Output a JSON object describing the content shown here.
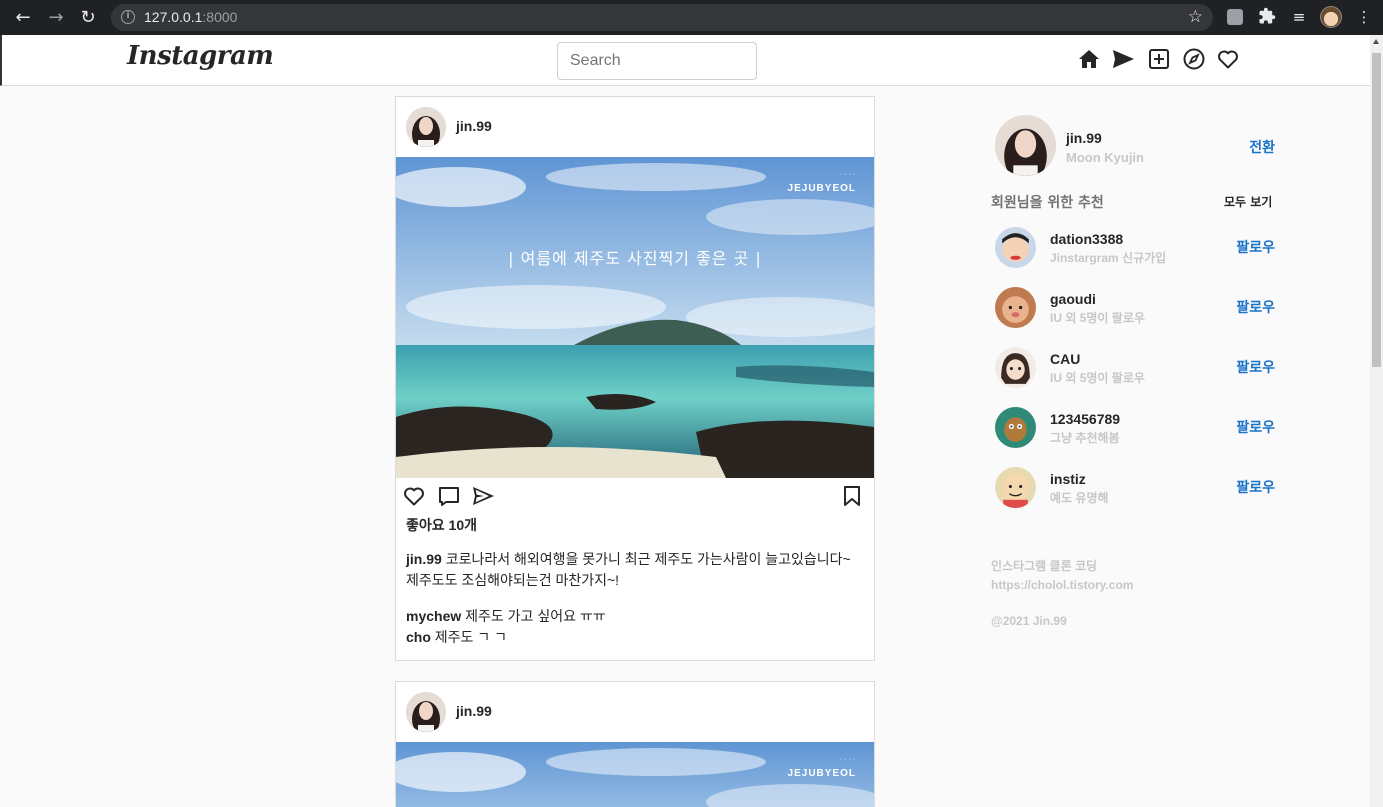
{
  "browser": {
    "url_host": "127.0.0.1",
    "url_port": ":8000"
  },
  "header": {
    "logo": "Instagram",
    "search_placeholder": "Search",
    "icons": [
      "home-icon",
      "direct-icon",
      "new-post-icon",
      "explore-icon",
      "activity-icon"
    ]
  },
  "posts": [
    {
      "username": "jin.99",
      "photo_title": "| 여름에 제주도 사진찍기 좋은 곳 |",
      "photo_brand": "JEJUBYEOL",
      "likes": "좋아요 10개",
      "caption_user": "jin.99",
      "caption_text": "코로나라서 해외여행을 못가니 최근 제주도 가는사람이 늘고있습니다~ 제주도도 조심해야되는건 마찬가지~!",
      "comments": [
        {
          "user": "mychew",
          "text": "제주도 가고 싶어요 ㅠㅠ"
        },
        {
          "user": "cho",
          "text": "제주도 ㄱ ㄱ"
        }
      ]
    },
    {
      "username": "jin.99",
      "photo_brand": "JEJUBYEOL"
    }
  ],
  "sidebar": {
    "profile": {
      "username": "jin.99",
      "name": "Moon Kyujin",
      "switch_label": "전환"
    },
    "reco_title": "회원님을 위한 추천",
    "see_all": "모두 보기",
    "follow_label": "팔로우",
    "recommendations": [
      {
        "username": "dation3388",
        "sub": "Jinstargram 신규가입"
      },
      {
        "username": "gaoudi",
        "sub": "IU 외 5명이 팔로우"
      },
      {
        "username": "CAU",
        "sub": "IU 외 5명이 팔로우"
      },
      {
        "username": "123456789",
        "sub": "그냥 추천해봄"
      },
      {
        "username": "instiz",
        "sub": "예도 유명해"
      }
    ],
    "footer": {
      "line1": "인스타그램 클론 코딩",
      "line2": "https://cholol.tistory.com",
      "copyright": "@2021 Jin.99"
    }
  },
  "colors": {
    "accent": "#1a73c9",
    "border": "#dbdbdb",
    "background": "#fafafa"
  }
}
